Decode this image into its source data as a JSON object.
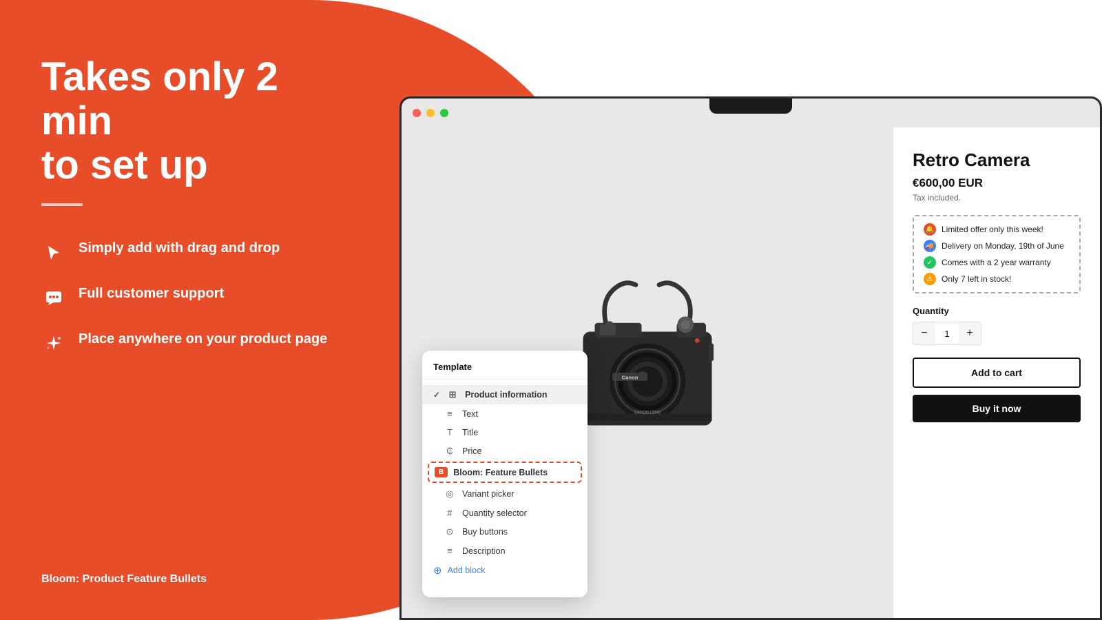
{
  "headline": {
    "line1": "Takes only 2 min",
    "line2": "to set up"
  },
  "features": [
    {
      "id": "drag-drop",
      "icon": "cursor",
      "text": "Simply add with drag and drop"
    },
    {
      "id": "support",
      "icon": "chat",
      "text": "Full customer support"
    },
    {
      "id": "anywhere",
      "icon": "sparkle",
      "text": "Place anywhere on your product page"
    }
  ],
  "bloom_label": "Bloom: Product Feature Bullets",
  "template_panel": {
    "title": "Template",
    "items": [
      {
        "id": "product-information",
        "icon": "☰",
        "label": "Product information",
        "active": true
      },
      {
        "id": "text",
        "icon": "≡",
        "label": "Text",
        "indent": true
      },
      {
        "id": "title",
        "icon": "T",
        "label": "Title",
        "indent": true
      },
      {
        "id": "price",
        "icon": "₵",
        "label": "Price",
        "indent": true
      },
      {
        "id": "bloom-feature-bullets",
        "icon": "B",
        "label": "Bloom: Feature Bullets",
        "bloom": true
      },
      {
        "id": "variant-picker",
        "icon": "◎",
        "label": "Variant picker",
        "indent": true
      },
      {
        "id": "quantity-selector",
        "icon": "#",
        "label": "Quantity selector",
        "indent": true
      },
      {
        "id": "buy-buttons",
        "icon": "⊙",
        "label": "Buy buttons",
        "indent": true
      },
      {
        "id": "description",
        "icon": "≡",
        "label": "Description",
        "indent": true
      }
    ],
    "add_block_label": "Add block"
  },
  "product": {
    "name": "Retro Camera",
    "price": "€600,00 EUR",
    "tax_text": "Tax included.",
    "bullets": [
      {
        "id": "limited-offer",
        "color": "red",
        "text": "Limited offer only this week!",
        "icon": "🔔"
      },
      {
        "id": "delivery",
        "color": "blue",
        "text": "Delivery on Monday, 19th of June",
        "icon": "🚚"
      },
      {
        "id": "warranty",
        "color": "green",
        "text": "Comes with a 2 year warranty",
        "icon": "✓"
      },
      {
        "id": "stock",
        "color": "yellow",
        "text": "Only 7 left in stock!",
        "icon": "⚠"
      }
    ],
    "quantity_label": "Quantity",
    "quantity_value": "1",
    "add_to_cart": "Add to cart",
    "buy_now": "Buy it now"
  }
}
